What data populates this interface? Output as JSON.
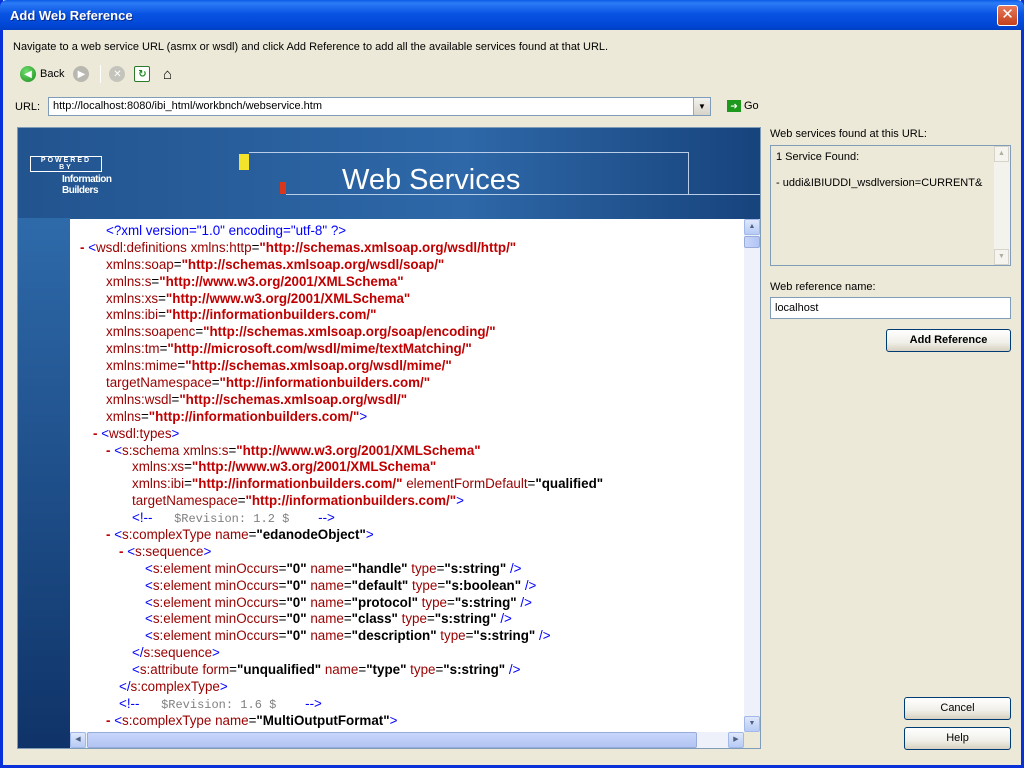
{
  "window": {
    "title": "Add Web Reference",
    "close_glyph": "✕"
  },
  "instruction": "Navigate to a web service URL (asmx or wsdl) and click Add Reference to add all the available services found at that URL.",
  "toolbar": {
    "back_label": "Back",
    "back_icon": "back-arrow-icon",
    "forward_icon": "forward-arrow-icon",
    "stop_icon": "stop-icon",
    "refresh_icon": "refresh-icon",
    "home_icon": "home-icon"
  },
  "url_bar": {
    "label": "URL:",
    "value": "http://localhost:8080/ibi_html/workbnch/webservice.htm",
    "go_label": "Go"
  },
  "banner": {
    "powered_by": "POWERED BY",
    "brand_line1": "Information",
    "brand_line2": "Builders",
    "title": "Web Services"
  },
  "xml": [
    [
      "",
      "<?xml version=\"1.0\" encoding=\"utf-8\" ?>"
    ],
    [
      "- ",
      "<wsdl:definitions xmlns:http=\"http://schemas.xmlsoap.org/wsdl/http/\""
    ],
    [
      "",
      "xmlns:soap=\"http://schemas.xmlsoap.org/wsdl/soap/\""
    ],
    [
      "",
      "xmlns:s=\"http://www.w3.org/2001/XMLSchema\""
    ],
    [
      "",
      "xmlns:xs=\"http://www.w3.org/2001/XMLSchema\""
    ],
    [
      "",
      "xmlns:ibi=\"http://informationbuilders.com/\""
    ],
    [
      "",
      "xmlns:soapenc=\"http://schemas.xmlsoap.org/soap/encoding/\""
    ],
    [
      "",
      "xmlns:tm=\"http://microsoft.com/wsdl/mime/textMatching/\""
    ],
    [
      "",
      "xmlns:mime=\"http://schemas.xmlsoap.org/wsdl/mime/\""
    ],
    [
      "",
      "targetNamespace=\"http://informationbuilders.com/\""
    ],
    [
      "",
      "xmlns:wsdl=\"http://schemas.xmlsoap.org/wsdl/\""
    ],
    [
      "",
      "xmlns=\"http://informationbuilders.com/\">"
    ],
    [
      "- ",
      "<wsdl:types>"
    ],
    [
      "- ",
      "<s:schema xmlns:s=\"http://www.w3.org/2001/XMLSchema\""
    ],
    [
      "",
      "xmlns:xs=\"http://www.w3.org/2001/XMLSchema\""
    ],
    [
      "",
      "xmlns:ibi=\"http://informationbuilders.com/\" elementFormDefault=\"qualified\""
    ],
    [
      "",
      "targetNamespace=\"http://informationbuilders.com/\">"
    ],
    [
      "",
      "<!--   $Revision: 1.2 $    -->"
    ],
    [
      "- ",
      "<s:complexType name=\"edanodeObject\">"
    ],
    [
      "- ",
      "<s:sequence>"
    ],
    [
      "",
      "<s:element minOccurs=\"0\" name=\"handle\" type=\"s:string\" />"
    ],
    [
      "",
      "<s:element minOccurs=\"0\" name=\"default\" type=\"s:boolean\" />"
    ],
    [
      "",
      "<s:element minOccurs=\"0\" name=\"protocol\" type=\"s:string\" />"
    ],
    [
      "",
      "<s:element minOccurs=\"0\" name=\"class\" type=\"s:string\" />"
    ],
    [
      "",
      "<s:element minOccurs=\"0\" name=\"description\" type=\"s:string\" />"
    ],
    [
      "",
      "</s:sequence>"
    ],
    [
      "",
      "<s:attribute form=\"unqualified\" name=\"type\" type=\"s:string\" />"
    ],
    [
      "",
      "</s:complexType>"
    ],
    [
      "",
      "<!--   $Revision: 1.6 $    -->"
    ],
    [
      "- ",
      "<s:complexType name=\"MultiOutputFormat\">"
    ]
  ],
  "side": {
    "found_label": "Web services found at this URL:",
    "found_line1": "1 Service Found:",
    "found_line2": "- uddi&IBIUDDI_wsdlversion=CURRENT&",
    "ref_name_label": "Web reference name:",
    "ref_name_value": "localhost",
    "add_reference": "Add Reference",
    "cancel": "Cancel",
    "help": "Help"
  },
  "colors": {
    "title_bar": "#0054e3",
    "tag": "#990000",
    "url_value": "#c00000",
    "pi": "#0000ff"
  }
}
